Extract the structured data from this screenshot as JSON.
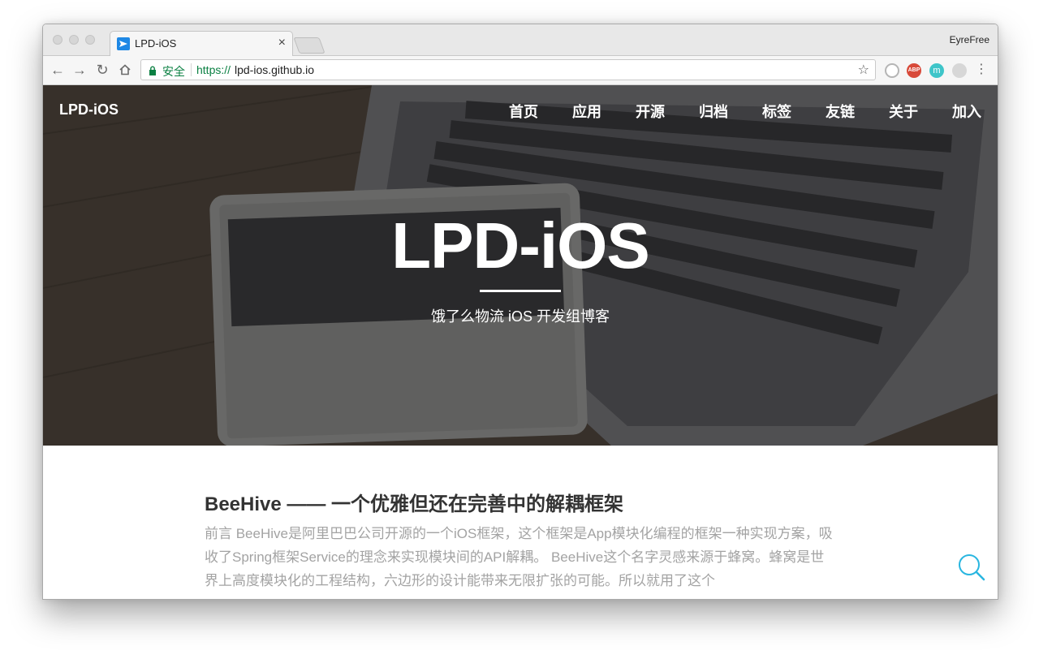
{
  "browser": {
    "tab_title": "LPD-iOS",
    "profile_name": "EyreFree",
    "secure_label": "安全",
    "url_scheme": "https://",
    "url_host": "lpd-ios.github.io",
    "extensions": [
      "ABP",
      "m"
    ]
  },
  "site": {
    "brand": "LPD-iOS",
    "nav": [
      "首页",
      "应用",
      "开源",
      "归档",
      "标签",
      "友链",
      "关于",
      "加入"
    ],
    "hero_title": "LPD-iOS",
    "hero_subtitle": "饿了么物流 iOS 开发组博客"
  },
  "post": {
    "title": "BeeHive —— 一个优雅但还在完善中的解耦框架",
    "excerpt": "前言 BeeHive是阿里巴巴公司开源的一个iOS框架，这个框架是App模块化编程的框架一种实现方案，吸收了Spring框架Service的理念来实现模块间的API解耦。 BeeHive这个名字灵感来源于蜂窝。蜂窝是世界上高度模块化的工程结构，六边形的设计能带来无限扩张的可能。所以就用了这个"
  },
  "colors": {
    "secure_green": "#0b8043",
    "accent_cyan": "#29b6e0",
    "abp_red": "#d84a3a",
    "m_teal": "#3ec5c9"
  }
}
